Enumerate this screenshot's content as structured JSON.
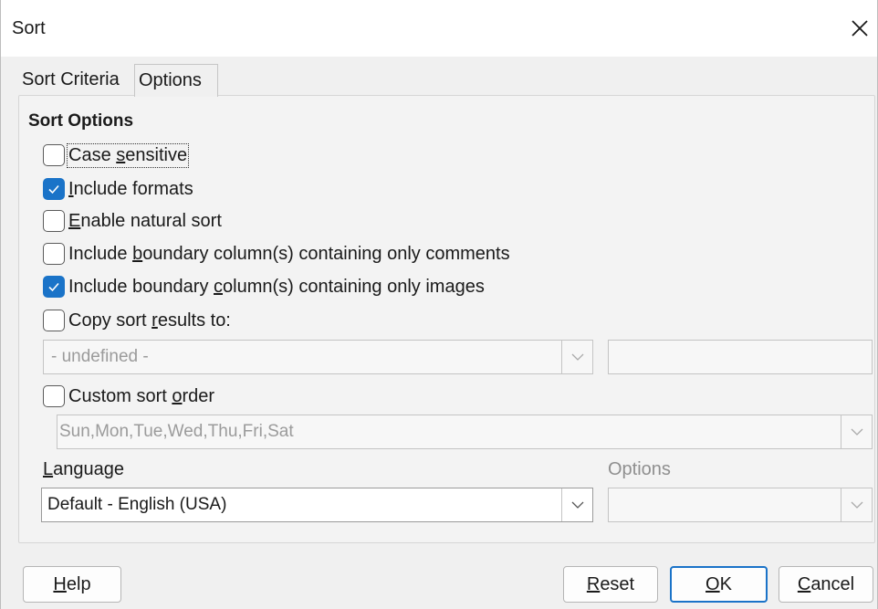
{
  "window": {
    "title": "Sort",
    "close_icon": "close-icon"
  },
  "tabs": [
    {
      "label": "Sort Criteria",
      "active": false
    },
    {
      "label": "Options",
      "active": true
    }
  ],
  "sort_options": {
    "title": "Sort Options",
    "checkboxes": [
      {
        "pre": "Case ",
        "mnemonic": "s",
        "post": "ensitive",
        "checked": false,
        "focused": true
      },
      {
        "pre": "",
        "mnemonic": "I",
        "post": "nclude formats",
        "checked": true
      },
      {
        "pre": "",
        "mnemonic": "E",
        "post": "nable natural sort",
        "checked": false
      },
      {
        "pre": "Include ",
        "mnemonic": "b",
        "post": "oundary column(s) containing only comments",
        "checked": false
      },
      {
        "pre": "Include boundary ",
        "mnemonic": "c",
        "post": "olumn(s) containing only images",
        "checked": true
      },
      {
        "pre": "Copy sort ",
        "mnemonic": "r",
        "post": "esults to:",
        "checked": false
      }
    ],
    "copy_target_select": {
      "value": "- undefined -",
      "enabled": false
    },
    "copy_target_text": {
      "value": "",
      "enabled": false
    },
    "custom_sort": {
      "pre": "Custom sort ",
      "mnemonic": "o",
      "post": "rder",
      "checked": false
    },
    "custom_sort_select": {
      "value": "Sun,Mon,Tue,Wed,Thu,Fri,Sat",
      "enabled": false
    },
    "language": {
      "mnemonic": "L",
      "post": "anguage",
      "value": "Default - English (USA)"
    },
    "options": {
      "label": "Options",
      "value": "",
      "enabled": false
    }
  },
  "buttons": {
    "help": {
      "mnemonic": "H",
      "post": "elp"
    },
    "reset": {
      "mnemonic": "R",
      "post": "eset"
    },
    "ok": {
      "mnemonic": "O",
      "post": "K"
    },
    "cancel": {
      "mnemonic": "C",
      "post": "ancel"
    }
  },
  "colors": {
    "accent": "#1a73c8",
    "background": "#f0f0f0"
  }
}
